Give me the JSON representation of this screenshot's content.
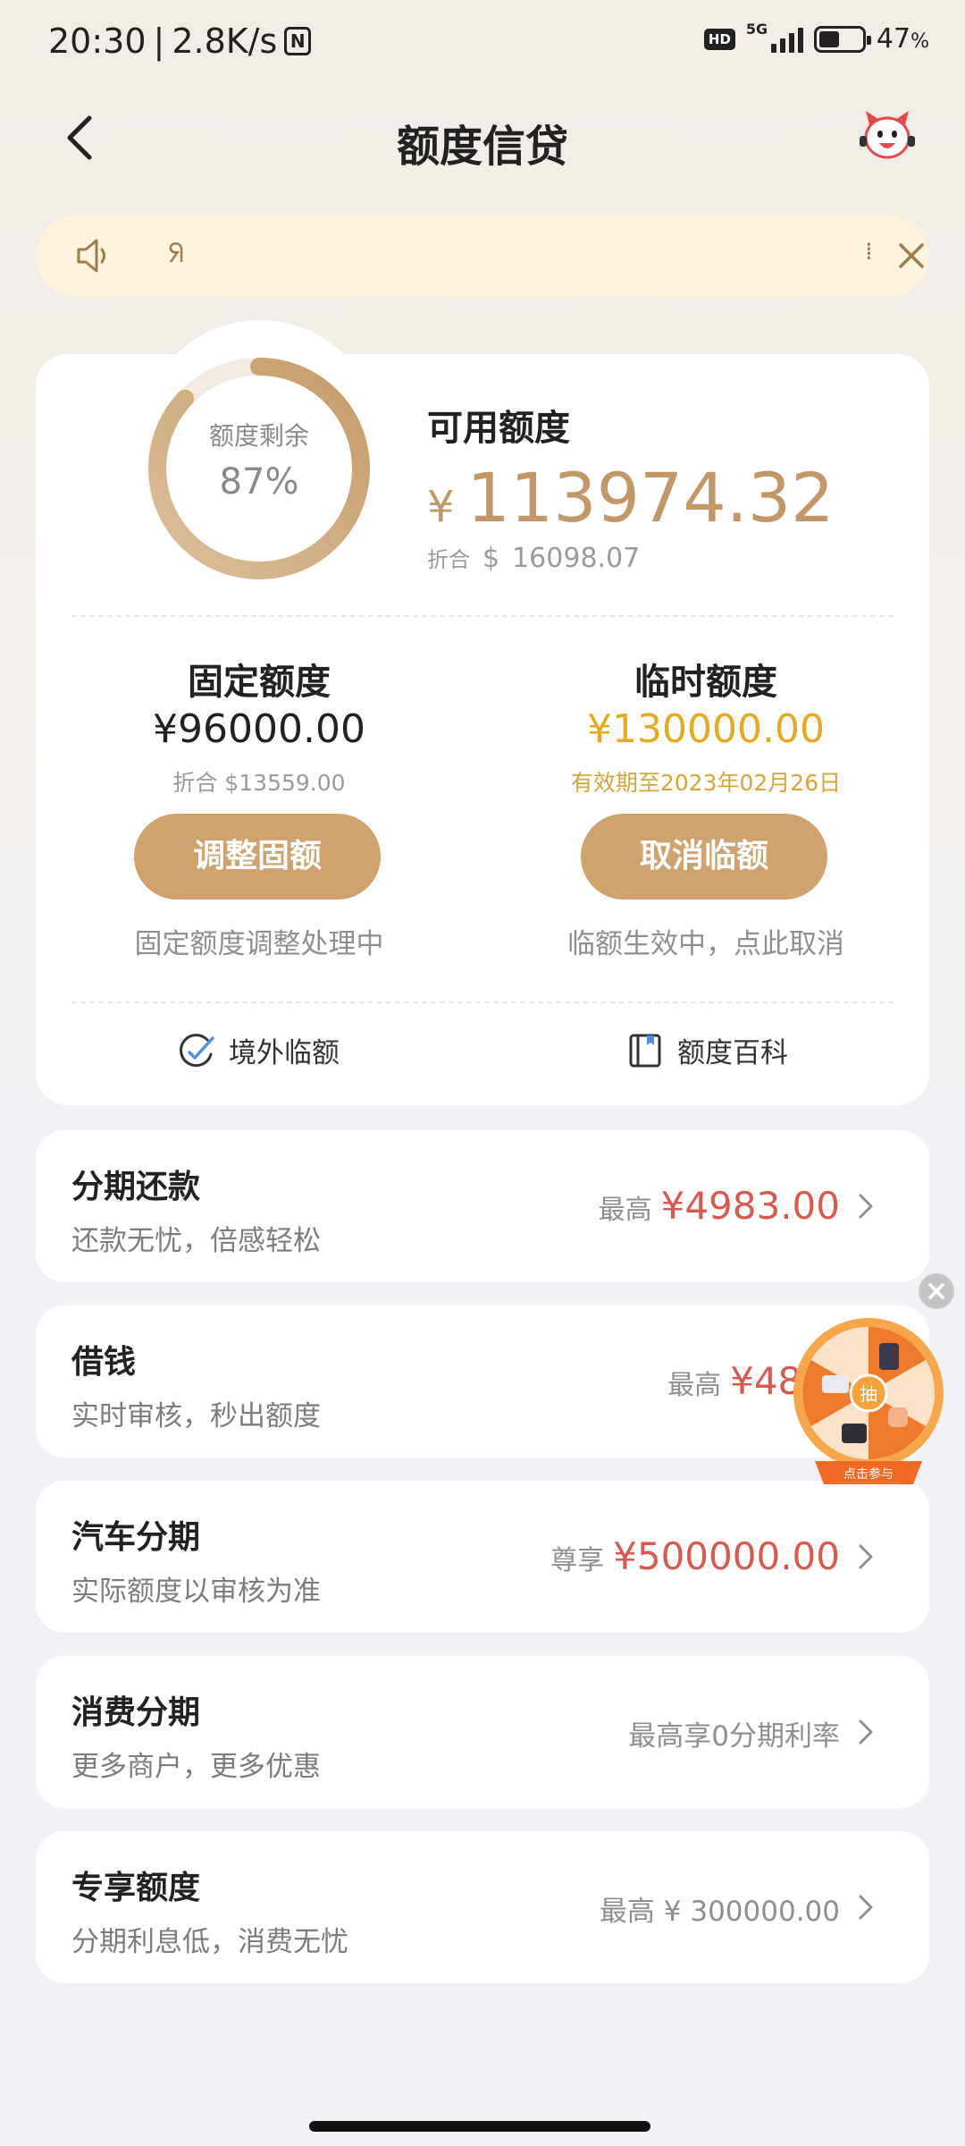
{
  "status_bar": {
    "time": "20:30",
    "net_speed": "2.8K/s",
    "nfc": "N",
    "hd": "HD",
    "network": "5G",
    "battery_percent": "47",
    "battery_unit": "%",
    "battery_level": 0.47
  },
  "header": {
    "title": "额度信贷"
  },
  "notice": {
    "glyph_left": "ᖆ",
    "glyph_right": "⁞"
  },
  "credit": {
    "ring_label": "额度剩余",
    "ring_value": "87%",
    "ring_fraction": 0.87,
    "available_label": "可用额度",
    "available_currency": "¥",
    "available_amount": "113974.32",
    "available_conv_label": "折合",
    "available_conv_currency": "$",
    "available_conv_value": "16098.07",
    "fixed": {
      "title": "固定额度",
      "amount": "¥96000.00",
      "sub": "折合 $13559.00",
      "button": "调整固额",
      "hint": "固定额度调整处理中"
    },
    "temporary": {
      "title": "临时额度",
      "amount": "¥130000.00",
      "sub": "有效期至2023年02月26日",
      "button": "取消临额",
      "hint": "临额生效中，点此取消"
    },
    "shortcuts": [
      {
        "label": "境外临额"
      },
      {
        "label": "额度百科"
      }
    ]
  },
  "products": [
    {
      "title": "分期还款",
      "sub": "还款无忧，倍感轻松",
      "prefix": "最高",
      "value": "¥4983.00"
    },
    {
      "title": "借钱",
      "sub": "实时审核，秒出额度",
      "prefix": "最高",
      "value": "¥480"
    },
    {
      "title": "汽车分期",
      "sub": "实际额度以审核为准",
      "prefix": "尊享",
      "value": "¥500000.00"
    },
    {
      "title": "消费分期",
      "sub": "更多商户，更多优惠",
      "prefix": "",
      "value": "最高享0分期利率"
    },
    {
      "title": "专享额度",
      "sub": "分期利息低，消费无忧",
      "prefix": "",
      "value": "最高 ¥ 300000.00"
    }
  ],
  "floating_wheel": {
    "center_label": "抽",
    "banner": "点击参与"
  },
  "colors": {
    "accent_gold": "#c49866",
    "button_gold": "#cfa26e",
    "temp_amount": "#e5aa1e",
    "price_red": "#d85a4e"
  }
}
